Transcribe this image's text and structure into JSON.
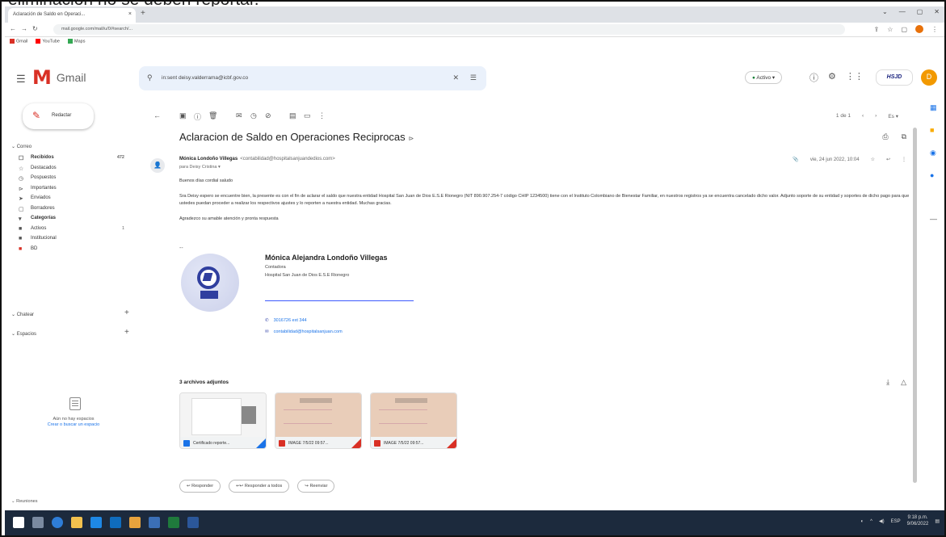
{
  "caption": "eliminación no se deben reportar.",
  "browser": {
    "tab_title": "Aclaración de Saldo en Operaci...",
    "tab_close": "×",
    "new_tab": "+",
    "window_controls": [
      "⌄",
      "—",
      "▢",
      "✕"
    ],
    "url": "mail.google.com/mail/u/0/#search/...",
    "bookmarks": [
      {
        "label": "Gmail",
        "color": "#d93025"
      },
      {
        "label": "YouTube",
        "color": "#ff0000"
      },
      {
        "label": "Maps",
        "color": "#34a853"
      }
    ]
  },
  "gmail": {
    "app_name": "Gmail",
    "search_value": "in:sent deisy.valderrama@icbf.gov.co",
    "status_label": "Activo",
    "org_badge": "HSJD",
    "avatar_letter": "D"
  },
  "sidebar": {
    "compose_label": "Redactar",
    "mail_section": "Correo",
    "items": [
      {
        "icon": "☐",
        "label": "Recibidos",
        "count": "472",
        "bold": true
      },
      {
        "icon": "☆",
        "label": "Destacados",
        "count": ""
      },
      {
        "icon": "◷",
        "label": "Pospuestos",
        "count": ""
      },
      {
        "icon": "⊳",
        "label": "Importantes",
        "count": ""
      },
      {
        "icon": "➤",
        "label": "Enviados",
        "count": ""
      },
      {
        "icon": "▢",
        "label": "Borradores",
        "count": ""
      },
      {
        "icon": "▾",
        "label": "Categorías",
        "count": "",
        "bold": true
      },
      {
        "icon": "■",
        "label": "Activos",
        "count": "1",
        "bold": false
      },
      {
        "icon": "■",
        "label": "Institucional",
        "count": ""
      },
      {
        "icon": "■",
        "label": "BD",
        "count": ""
      }
    ],
    "chat_section": "Chatear",
    "spaces_section": "Espacios",
    "no_spaces_text": "Aún no hay espacios",
    "create_space_link": "Crear o buscar un espacio",
    "recent_section": "Reuniones"
  },
  "toolbar": {
    "icons": [
      "←",
      "▣",
      "ⓘ",
      "🗑",
      "✉",
      "◷",
      "⊘",
      "▤",
      "▭",
      "⋮"
    ],
    "pager": "1 de 1",
    "lang": "Es"
  },
  "email": {
    "subject": "Aclaracion de Saldo en Operaciones Reciprocas",
    "subject_label": "⊳",
    "sender_name": "Mónica Londoño Villegas",
    "sender_email": "<contabilidad@hospitalsanjuandedios.com>",
    "recipient": "para Deisy Cristina ▾",
    "date": "vie, 24 jun 2022, 10:04",
    "greeting": "Buenos días cordial saludo",
    "body_paragraph": "Sra Deisy espero se encuentre bien, la presente es con el fin de aclarar el saldo que nuestra entidad Hospital San Juan de Dios E.S.E Rionegro (NIT 890.907.254-7 código CHIP 1234500) tiene con el Instituto Colombiano de Bienestar Familiar, en nuestros registros ya se encuentra cancelado dicho valor. Adjunto soporte de su entidad y soportes de dicho pago para que ustedes puedan proceder a realizar los respectivos ajustes y lo reporten a nuestra entidad. Muchas gracias.",
    "closing": "Agradezco su amable atención y pronta respuesta",
    "sig_dash": "--",
    "sig_name": "Mónica Alejandra Londoño Villegas",
    "sig_role": "Contadora",
    "sig_org": "Hospital San Juan de Dios E.S.E Rionegro",
    "sig_phone": "3016726 ext 344",
    "sig_email": "contabilidad@hospitalsanjuan.com"
  },
  "attachments": {
    "header": "3 archivos adjuntos",
    "items": [
      {
        "name": "Certificado reporte...",
        "type_color": "#1a73e8",
        "preview": "doc"
      },
      {
        "name": "IMAGE 7/5/22 09:57...",
        "type_color": "#d93025",
        "preview": "img"
      },
      {
        "name": "IMAGE 7/5/22 09:57...",
        "type_color": "#d93025",
        "preview": "img"
      }
    ]
  },
  "reply": {
    "reply_label": "Responder",
    "reply_all_label": "Responder a todos",
    "forward_label": "Reenviar"
  },
  "taskbar": {
    "time": "9:18 p.m.",
    "date": "9/06/2022",
    "lang": "ESP"
  }
}
